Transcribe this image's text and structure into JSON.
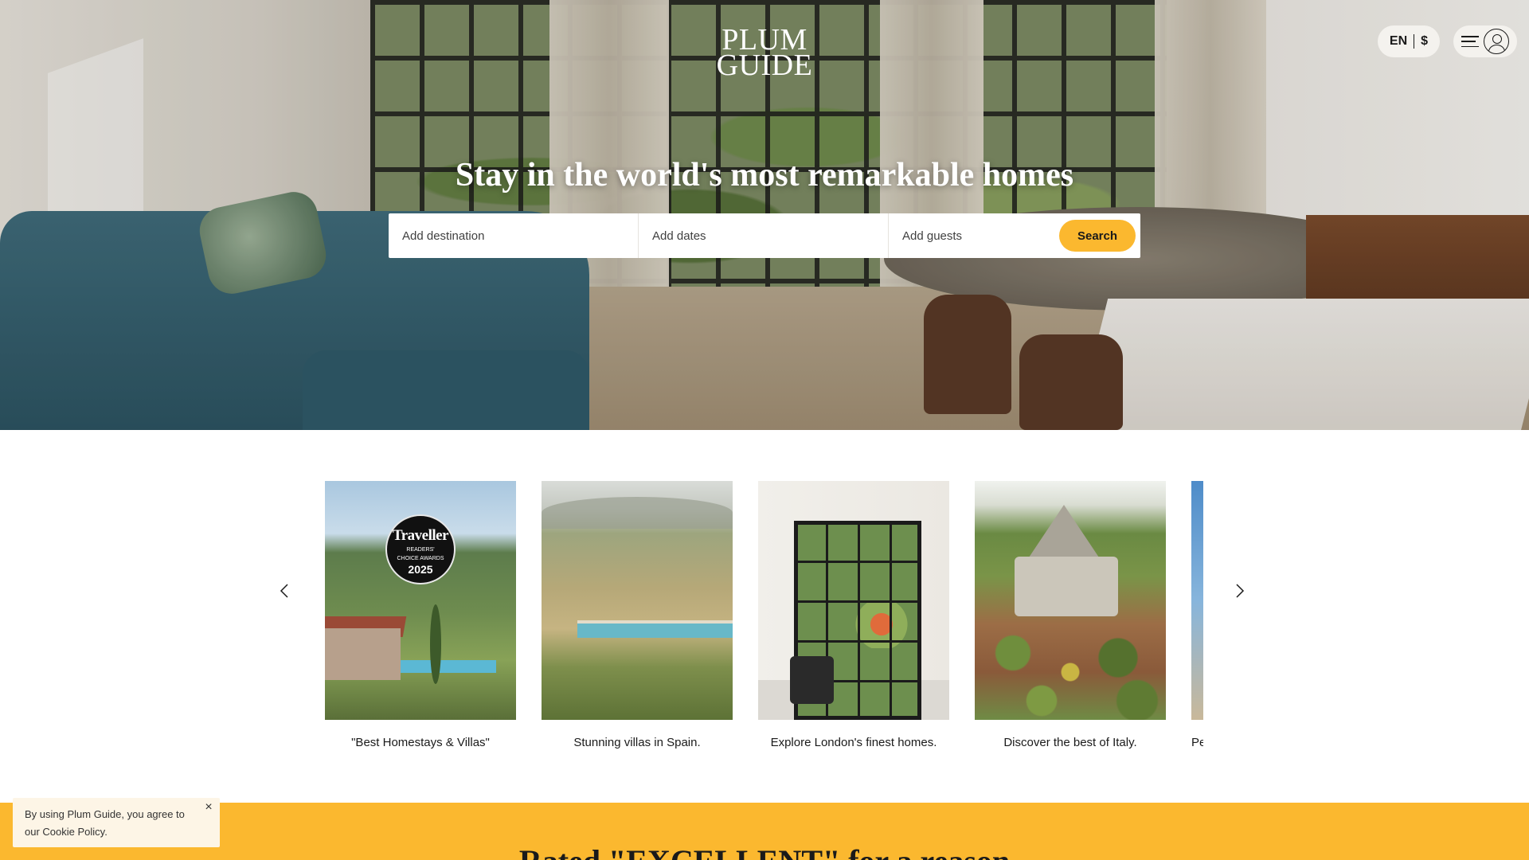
{
  "header": {
    "logo_line1": "PLUM",
    "logo_line2": "GUIDE",
    "language": "EN",
    "currency": "$",
    "menu_icon": "hamburger-icon",
    "account_icon": "user-icon"
  },
  "hero": {
    "title": "Stay in the world's most remarkable homes"
  },
  "search": {
    "destination_placeholder": "Add destination",
    "dates_placeholder": "Add dates",
    "guests_placeholder": "Add guests",
    "button_label": "Search",
    "button_color": "#fbb82f"
  },
  "carousel": {
    "prev_icon": "chevron-left-icon",
    "next_icon": "chevron-right-icon",
    "cards": [
      {
        "caption": "\"Best Homestays & Villas\"",
        "badge": {
          "brand": "Traveller",
          "line1": "READERS'",
          "line2": "CHOICE AWARDS",
          "year": "2025"
        }
      },
      {
        "caption": "Stunning villas in Spain."
      },
      {
        "caption": "Explore London's finest homes."
      },
      {
        "caption": "Discover the best of Italy."
      },
      {
        "caption": "Pe"
      }
    ]
  },
  "rated": {
    "title": "Rated \"EXCELLENT\" for a reason",
    "background": "#fbb82f"
  },
  "cookie": {
    "text": "By using Plum Guide, you agree to our Cookie Policy.",
    "close": "×"
  }
}
